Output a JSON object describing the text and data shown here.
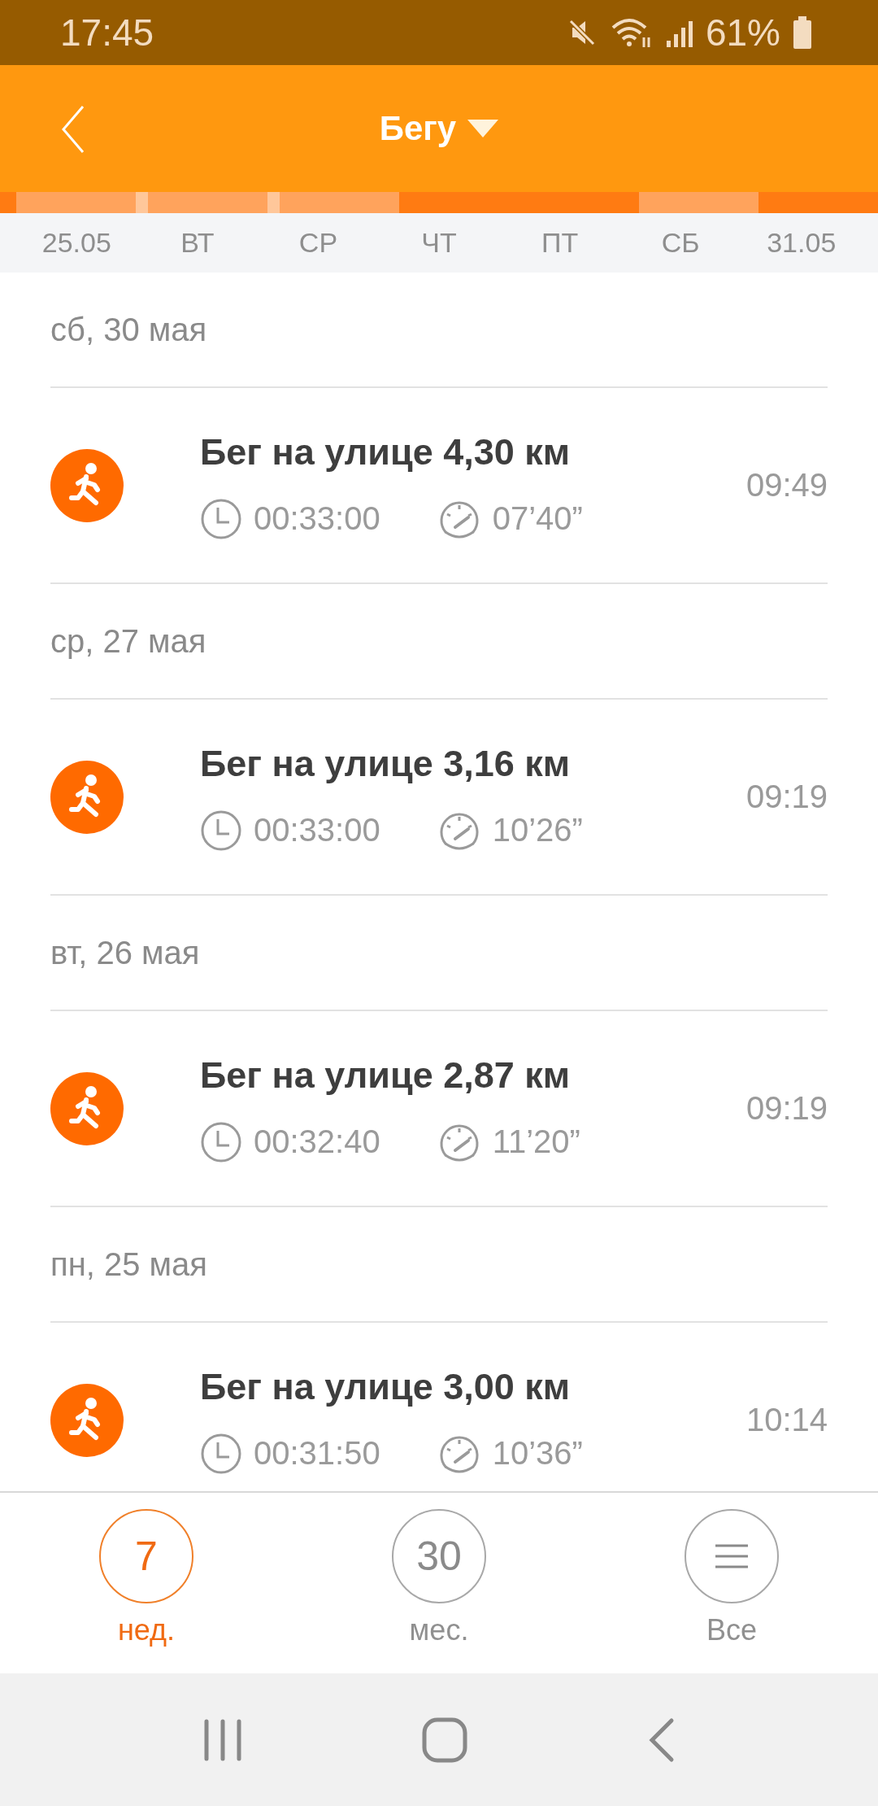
{
  "status_bar": {
    "time": "17:45",
    "battery": "61%"
  },
  "header": {
    "title": "Бегу"
  },
  "week_strip": [
    {
      "label": "25.05",
      "active": true
    },
    {
      "label": "ВТ",
      "active": true
    },
    {
      "label": "СР",
      "active": true
    },
    {
      "label": "ЧТ",
      "active": false
    },
    {
      "label": "ПТ",
      "active": false
    },
    {
      "label": "СБ",
      "active": true
    },
    {
      "label": "31.05",
      "active": false
    }
  ],
  "sessions": [
    {
      "date": "сб, 30 мая",
      "title": "Бег на улице 4,30 км",
      "duration": "00:33:00",
      "pace": "07’40”",
      "time": "09:49"
    },
    {
      "date": "ср, 27 мая",
      "title": "Бег на улице 3,16 км",
      "duration": "00:33:00",
      "pace": "10’26”",
      "time": "09:19"
    },
    {
      "date": "вт, 26 мая",
      "title": "Бег на улице 2,87 км",
      "duration": "00:32:40",
      "pace": "11’20”",
      "time": "09:19"
    },
    {
      "date": "пн, 25 мая",
      "title": "Бег на улице 3,00 км",
      "duration": "00:31:50",
      "pace": "10’36”",
      "time": "10:14"
    }
  ],
  "tabs": [
    {
      "kind": "number",
      "label": "7",
      "caption": "нед.",
      "selected": true
    },
    {
      "kind": "number",
      "label": "30",
      "caption": "мес.",
      "selected": false
    },
    {
      "kind": "menu",
      "caption": "Все",
      "selected": false
    }
  ]
}
